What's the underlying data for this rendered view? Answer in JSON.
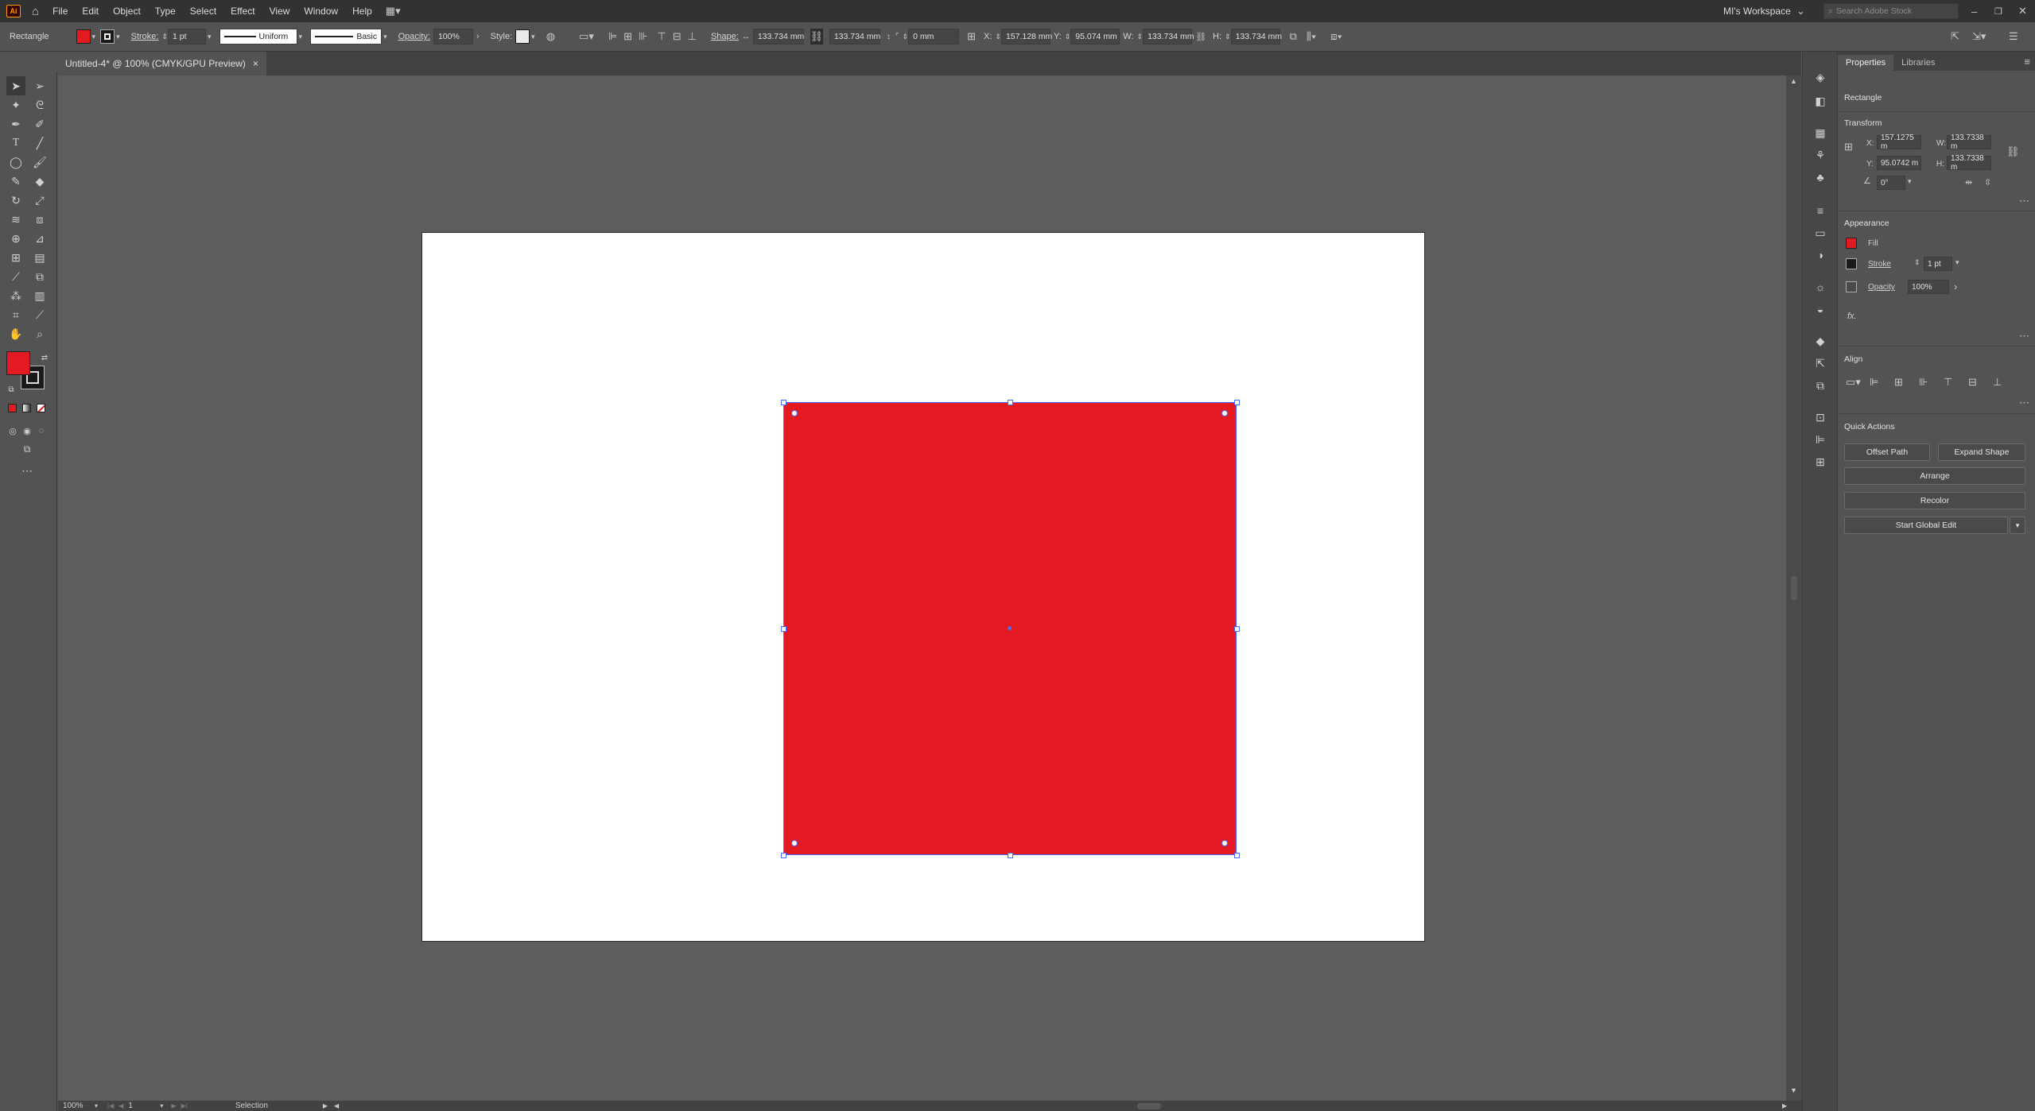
{
  "app": {
    "logo": "Ai",
    "workspace": "MI's Workspace",
    "search_placeholder": "Search Adobe Stock"
  },
  "menu": [
    "File",
    "Edit",
    "Object",
    "Type",
    "Select",
    "Effect",
    "View",
    "Window",
    "Help"
  ],
  "control_bar": {
    "object_type": "Rectangle",
    "stroke_label": "Stroke:",
    "stroke_value": "1 pt",
    "stroke_profile": "Uniform",
    "brush": "Basic",
    "opacity_label": "Opacity:",
    "opacity_value": "100%",
    "style_label": "Style:",
    "shape_label": "Shape:",
    "shape_w": "133.734 mm",
    "shape_h": "133.734 mm",
    "corner": "0 mm",
    "x_label": "X:",
    "x_value": "157.128 mm",
    "y_label": "Y:",
    "y_value": "95.074 mm",
    "w_label": "W:",
    "w_value": "133.734 mm",
    "h_label": "H:",
    "h_value": "133.734 mm",
    "fill_color": "#e31a22"
  },
  "document_tab": {
    "title": "Untitled-4* @ 100% (CMYK/GPU Preview)",
    "close": "×"
  },
  "panel": {
    "tabs": [
      "Properties",
      "Libraries"
    ],
    "selection": "Rectangle",
    "transform": {
      "title": "Transform",
      "x_label": "X:",
      "x": "157.1275 m",
      "y_label": "Y:",
      "y": "95.0742 m",
      "w_label": "W:",
      "w": "133.7338 m",
      "h_label": "H:",
      "h": "133.7338 m",
      "angle": "0°"
    },
    "appearance": {
      "title": "Appearance",
      "fill": "Fill",
      "stroke": "Stroke",
      "stroke_value": "1 pt",
      "opacity": "Opacity",
      "opacity_value": "100%",
      "fx": "fx."
    },
    "align": {
      "title": "Align"
    },
    "quick_actions": {
      "title": "Quick Actions",
      "offset_path": "Offset Path",
      "expand_shape": "Expand Shape",
      "arrange": "Arrange",
      "recolor": "Recolor",
      "global_edit": "Start Global Edit"
    }
  },
  "status": {
    "zoom": "100%",
    "artboard": "1",
    "tool": "Selection"
  }
}
